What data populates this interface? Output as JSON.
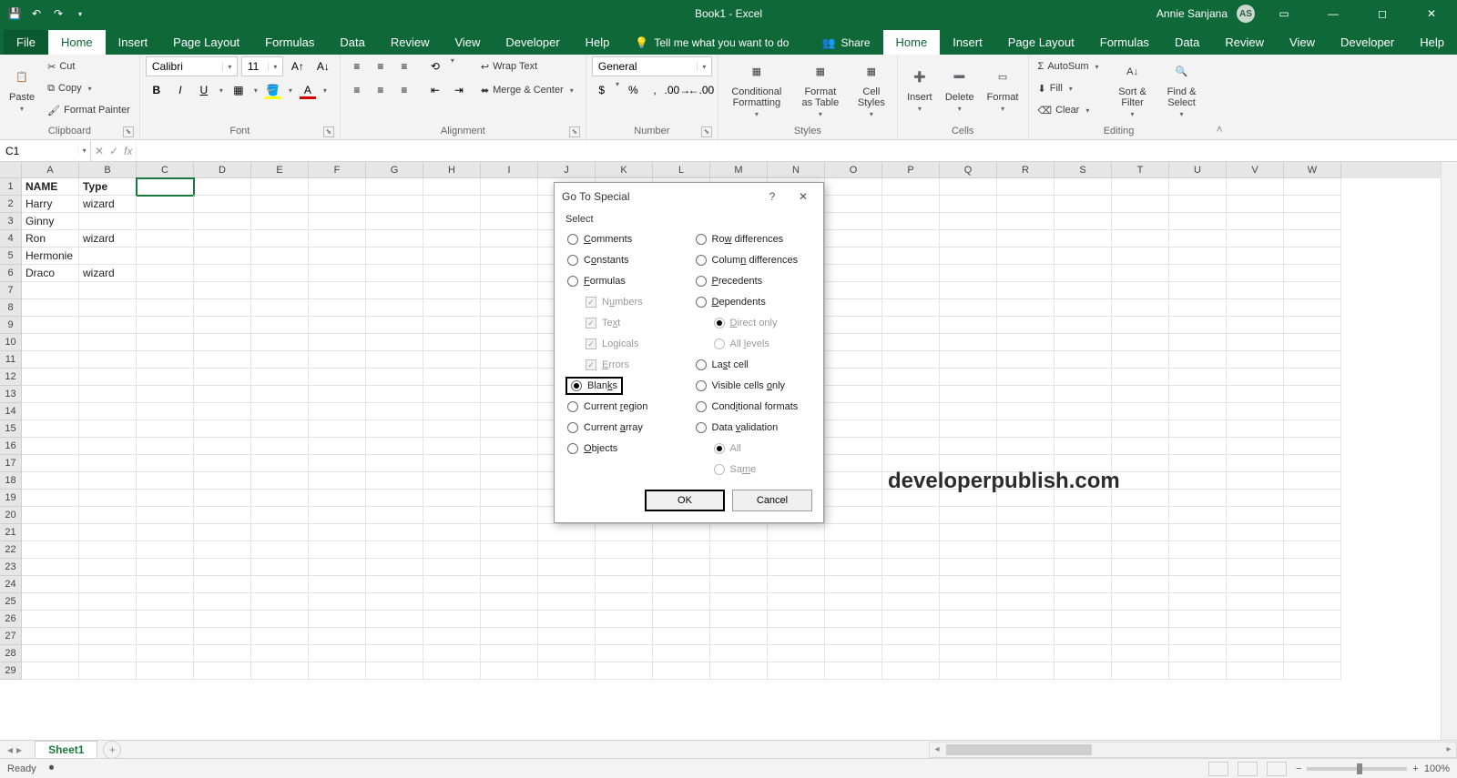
{
  "titlebar": {
    "doc_title": "Book1 - Excel",
    "user_name": "Annie Sanjana",
    "user_initials": "AS"
  },
  "tabs": {
    "file": "File",
    "items": [
      "Home",
      "Insert",
      "Page Layout",
      "Formulas",
      "Data",
      "Review",
      "View",
      "Developer",
      "Help"
    ],
    "active_index": 0,
    "tell_me": "Tell me what you want to do",
    "share": "Share"
  },
  "ribbon": {
    "clipboard": {
      "paste": "Paste",
      "cut": "Cut",
      "copy": "Copy",
      "format_painter": "Format Painter",
      "caption": "Clipboard"
    },
    "font": {
      "name": "Calibri",
      "size": "11",
      "caption": "Font"
    },
    "alignment": {
      "wrap": "Wrap Text",
      "merge": "Merge & Center",
      "caption": "Alignment"
    },
    "number": {
      "format": "General",
      "caption": "Number"
    },
    "styles": {
      "cond": "Conditional Formatting",
      "table": "Format as Table",
      "cell": "Cell Styles",
      "caption": "Styles"
    },
    "cells": {
      "insert": "Insert",
      "delete": "Delete",
      "format": "Format",
      "caption": "Cells"
    },
    "editing": {
      "autosum": "AutoSum",
      "fill": "Fill",
      "clear": "Clear",
      "sort": "Sort & Filter",
      "find": "Find & Select",
      "caption": "Editing"
    }
  },
  "namebox": "C1",
  "columns": [
    "A",
    "B",
    "C",
    "D",
    "E",
    "F",
    "G",
    "H",
    "I",
    "J",
    "K",
    "L",
    "M",
    "N",
    "O",
    "P",
    "Q",
    "R",
    "S",
    "T",
    "U",
    "V",
    "W"
  ],
  "row_count": 29,
  "data_rows": [
    {
      "A": "NAME",
      "B": "Type",
      "bold": true
    },
    {
      "A": "Harry",
      "B": "wizard"
    },
    {
      "A": "Ginny",
      "B": ""
    },
    {
      "A": "Ron",
      "B": "wizard"
    },
    {
      "A": "Hermonie",
      "B": ""
    },
    {
      "A": "Draco",
      "B": "wizard"
    }
  ],
  "active_cell": {
    "row": 1,
    "col": "C"
  },
  "dialog": {
    "title": "Go To Special",
    "select_label": "Select",
    "left": [
      {
        "type": "radio",
        "label": "Comments",
        "u": 0
      },
      {
        "type": "radio",
        "label": "Constants",
        "u": 1
      },
      {
        "type": "radio",
        "label": "Formulas",
        "u": 0
      },
      {
        "type": "check",
        "label": "Numbers",
        "u": 1,
        "indent": true,
        "disabled": true,
        "checked": true
      },
      {
        "type": "check",
        "label": "Text",
        "u": 2,
        "indent": true,
        "disabled": true,
        "checked": true
      },
      {
        "type": "check",
        "label": "Logicals",
        "u": 2,
        "indent": true,
        "disabled": true,
        "checked": true
      },
      {
        "type": "check",
        "label": "Errors",
        "u": 0,
        "indent": true,
        "disabled": true,
        "checked": true
      },
      {
        "type": "radio",
        "label": "Blanks",
        "u": 4,
        "selected": true,
        "boxed": true
      },
      {
        "type": "radio",
        "label": "Current region",
        "u": 8
      },
      {
        "type": "radio",
        "label": "Current array",
        "u": 8
      },
      {
        "type": "radio",
        "label": "Objects",
        "u": 0
      }
    ],
    "right": [
      {
        "type": "radio",
        "label": "Row differences",
        "u": 2
      },
      {
        "type": "radio",
        "label": "Column differences",
        "u": 5
      },
      {
        "type": "radio",
        "label": "Precedents",
        "u": 0
      },
      {
        "type": "radio",
        "label": "Dependents",
        "u": 0
      },
      {
        "type": "radio",
        "label": "Direct only",
        "u": 0,
        "indent": true,
        "disabled": true,
        "sub": true,
        "selected": true
      },
      {
        "type": "radio",
        "label": "All levels",
        "u": 4,
        "indent": true,
        "disabled": true,
        "sub": true
      },
      {
        "type": "radio",
        "label": "Last cell",
        "u": 2
      },
      {
        "type": "radio",
        "label": "Visible cells only",
        "u": 14
      },
      {
        "type": "radio",
        "label": "Conditional formats",
        "u": 4
      },
      {
        "type": "radio",
        "label": "Data validation",
        "u": 5
      },
      {
        "type": "radio",
        "label": "All",
        "u": -1,
        "indent": true,
        "disabled": true,
        "sub": true,
        "selected": true
      },
      {
        "type": "radio",
        "label": "Same",
        "u": 2,
        "indent": true,
        "disabled": true,
        "sub": true
      }
    ],
    "ok": "OK",
    "cancel": "Cancel"
  },
  "watermark": "developerpublish.com",
  "sheet": {
    "name": "Sheet1"
  },
  "status": {
    "ready": "Ready",
    "zoom": "100%"
  }
}
